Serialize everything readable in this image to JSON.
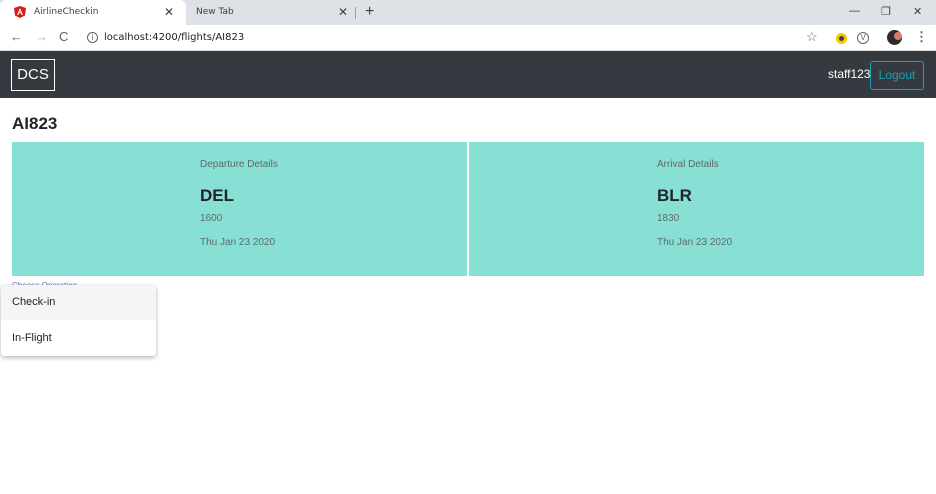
{
  "browser": {
    "tabs": [
      {
        "title": "AirlineCheckin",
        "favicon": "angular-icon",
        "active": true
      },
      {
        "title": "New Tab",
        "active": false
      }
    ],
    "url": "localhost:4200/flights/AI823"
  },
  "navbar": {
    "brand": "DCS",
    "username": "staff123",
    "logout_label": "Logout"
  },
  "flight": {
    "number": "AI823",
    "departure": {
      "label": "Departure Details",
      "code": "DEL",
      "time": "1600",
      "date": "Thu Jan 23 2020"
    },
    "arrival": {
      "label": "Arrival Details",
      "code": "BLR",
      "time": "1830",
      "date": "Thu Jan 23 2020"
    }
  },
  "operation_select": {
    "label": "Choose Operation",
    "options": [
      "Check-in",
      "In-Flight"
    ]
  },
  "colors": {
    "navbar_bg": "#343a40",
    "card_bg": "#88dfd4",
    "logout_accent": "#17a2b8",
    "angular_red": "#dd1b16"
  }
}
